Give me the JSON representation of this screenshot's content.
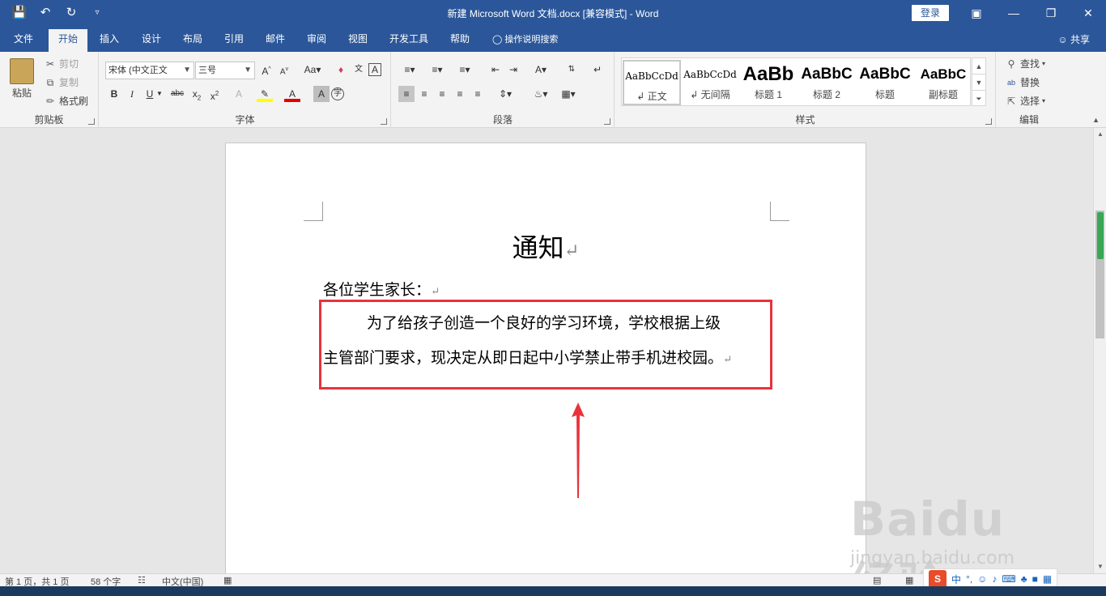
{
  "titlebar": {
    "title": "新建 Microsoft Word 文档.docx [兼容模式] - Word",
    "login": "登录",
    "qat_icons": [
      "save-icon",
      "undo-icon",
      "redo-icon",
      "customize-qat-icon"
    ],
    "window_controls": [
      "ribbon-display-options-icon",
      "minimize-icon",
      "restore-icon",
      "close-icon"
    ]
  },
  "tabs": {
    "items": [
      "文件",
      "开始",
      "插入",
      "设计",
      "布局",
      "引用",
      "邮件",
      "审阅",
      "视图",
      "开发工具",
      "帮助"
    ],
    "active": "开始",
    "tell_me": "操作说明搜索",
    "share": "共享"
  },
  "clipboard": {
    "paste": "粘贴",
    "cut": "剪切",
    "copy": "复制",
    "format_painter": "格式刷",
    "label": "剪贴板"
  },
  "font": {
    "font_name": "宋体 (中文正文",
    "font_size": "三号",
    "label": "字体"
  },
  "paragraph": {
    "label": "段落"
  },
  "styles": {
    "items": [
      {
        "sample": "AaBbCcDd",
        "name": "↲ 正文"
      },
      {
        "sample": "AaBbCcDd",
        "name": "↲ 无间隔"
      },
      {
        "sample": "AaBb",
        "name": "标题 1"
      },
      {
        "sample": "AaBbC",
        "name": "标题 2"
      },
      {
        "sample": "AaBbC",
        "name": "标题"
      },
      {
        "sample": "AaBbC",
        "name": "副标题"
      }
    ],
    "label": "样式"
  },
  "editing": {
    "find": "查找",
    "replace": "替换",
    "select": "选择",
    "label": "编辑"
  },
  "document": {
    "title": "通知",
    "greeting": "各位学生家长：",
    "para_line1": "为了给孩子创造一个良好的学习环境，学校根据上级",
    "para_line2": "主管部门要求，现决定从即日起中小学禁止带手机进校园。",
    "highlight_color": "#e8333c"
  },
  "statusbar": {
    "page": "第 1 页，共 1 页",
    "words": "58 个字",
    "language": "中文(中国)"
  },
  "ime": {
    "logo": "S",
    "mode": "中"
  },
  "watermark": {
    "brand": "Baidu经验",
    "url": "jingyan.baidu.com"
  }
}
